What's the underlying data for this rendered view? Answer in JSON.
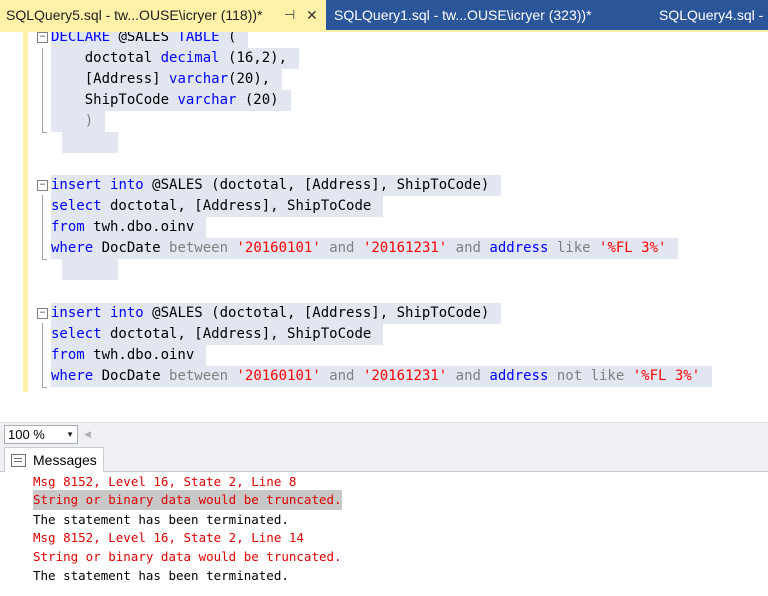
{
  "tabs": [
    {
      "label": "SQLQuery5.sql - tw...OUSE\\icryer (118))*",
      "active": true
    },
    {
      "label": "SQLQuery1.sql - tw...OUSE\\icryer (323))*",
      "active": false
    },
    {
      "label": "SQLQuery4.sql -",
      "active": false
    }
  ],
  "editor": {
    "l1": {
      "kw1": "DECLARE",
      "t1": " @SALES ",
      "kw2": "TABLE",
      "t2": " ("
    },
    "l2": {
      "t1": "    doctotal ",
      "kw1": "decimal",
      "t2": " (16,2),"
    },
    "l3": {
      "t1": "    [Address] ",
      "kw1": "varchar",
      "t2": "(20),"
    },
    "l4": {
      "t1": "    ShipToCode ",
      "kw1": "varchar",
      "t2": " (20)"
    },
    "l5": {
      "t1": "    )"
    },
    "l8": {
      "kw1": "insert",
      "t1": " ",
      "kw2": "into",
      "t2": " @SALES (doctotal, [Address], ShipToCode)"
    },
    "l9": {
      "kw1": "select",
      "t1": " doctotal, [Address], ShipToCode"
    },
    "l10": {
      "kw1": "from",
      "t1": " twh.dbo.oinv"
    },
    "l11": {
      "kw1": "where",
      "t1": " DocDate ",
      "g1": "between",
      "t2": " ",
      "s1": "'20160101'",
      "t3": " ",
      "g2": "and",
      "t4": " ",
      "s2": "'20161231'",
      "t5": " ",
      "g3": "and",
      "t6": " ",
      "kw2": "address",
      "t7": " ",
      "g4": "like",
      "t8": " ",
      "s3": "'%FL 3%'"
    },
    "l14": {
      "kw1": "insert",
      "t1": " ",
      "kw2": "into",
      "t2": " @SALES (doctotal, [Address], ShipToCode)"
    },
    "l15": {
      "kw1": "select",
      "t1": " doctotal, [Address], ShipToCode"
    },
    "l16": {
      "kw1": "from",
      "t1": " twh.dbo.oinv"
    },
    "l17": {
      "kw1": "where",
      "t1": " DocDate ",
      "g1": "between",
      "t2": " ",
      "s1": "'20160101'",
      "t3": " ",
      "g2": "and",
      "t4": " ",
      "s2": "'20161231'",
      "t5": " ",
      "g3": "and",
      "t6": " ",
      "kw2": "address",
      "t7": " ",
      "g4": "not like",
      "t8": " ",
      "s3": "'%FL 3%'"
    }
  },
  "zoom": {
    "value": "100 %"
  },
  "results": {
    "tab_label": "Messages",
    "lines": [
      {
        "text": "Msg 8152, Level 16, State 2, Line 8",
        "type": "error"
      },
      {
        "text": "String or binary data would be truncated.",
        "type": "error",
        "selected": true
      },
      {
        "text": "The statement has been terminated.",
        "type": "info"
      },
      {
        "text": "Msg 8152, Level 16, State 2, Line 14",
        "type": "error"
      },
      {
        "text": "String or binary data would be truncated.",
        "type": "error"
      },
      {
        "text": "The statement has been terminated.",
        "type": "info"
      }
    ]
  },
  "colors": {
    "keyword": "#0000ff",
    "string": "#ff0000",
    "operator": "#808080",
    "tab_active": "#fff1a8",
    "tab_strip": "#2b579a",
    "error": "#e00000"
  },
  "icons": {
    "pin": "pin-icon",
    "close": "close-icon",
    "messages": "messages-icon",
    "dropdown": "chevron-down-icon"
  }
}
